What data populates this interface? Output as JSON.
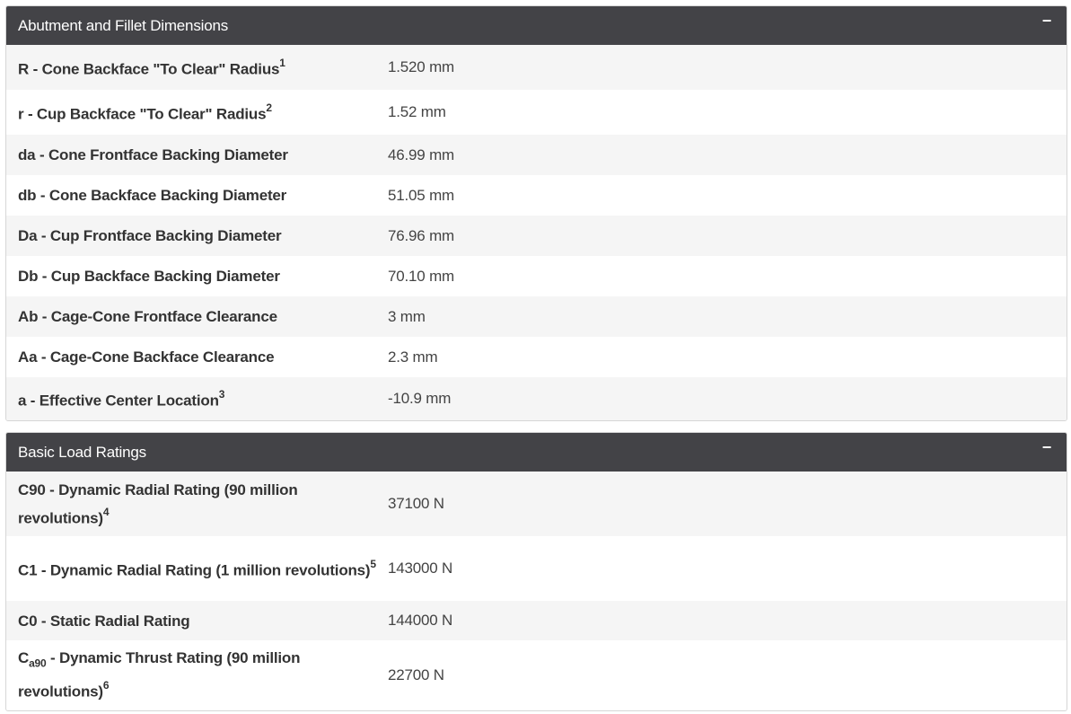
{
  "abutment": {
    "title": "Abutment and Fillet Dimensions",
    "toggle": "−",
    "rows": [
      {
        "label": "R - Cone Backface \"To Clear\" Radius",
        "sup": "1",
        "value": "1.520 mm"
      },
      {
        "label": "r - Cup Backface \"To Clear\" Radius",
        "sup": "2",
        "value": "1.52 mm"
      },
      {
        "label": "da - Cone Frontface Backing Diameter",
        "value": "46.99 mm"
      },
      {
        "label": "db - Cone Backface Backing Diameter",
        "value": "51.05 mm"
      },
      {
        "label": "Da - Cup Frontface Backing Diameter",
        "value": "76.96 mm"
      },
      {
        "label": "Db - Cup Backface Backing Diameter",
        "value": "70.10 mm"
      },
      {
        "label": "Ab - Cage-Cone Frontface Clearance",
        "value": "3 mm"
      },
      {
        "label": "Aa - Cage-Cone Backface Clearance",
        "value": "2.3 mm"
      },
      {
        "label": "a - Effective Center Location",
        "sup": "3",
        "value": "-10.9 mm"
      }
    ]
  },
  "load": {
    "title": "Basic Load Ratings",
    "toggle": "−",
    "rows": [
      {
        "label": "C90 - Dynamic Radial Rating (90 million revolutions)",
        "sup": "4",
        "value": "37100 N"
      },
      {
        "label": "C1 - Dynamic Radial Rating (1 million revolutions)",
        "sup": "5",
        "value": "143000 N"
      },
      {
        "label": "C0 - Static Radial Rating",
        "value": "144000 N"
      },
      {
        "label_prefix": "C",
        "label_sub": "a90",
        "label": " - Dynamic Thrust Rating (90 million revolutions)",
        "sup": "6",
        "value": "22700 N"
      }
    ]
  }
}
